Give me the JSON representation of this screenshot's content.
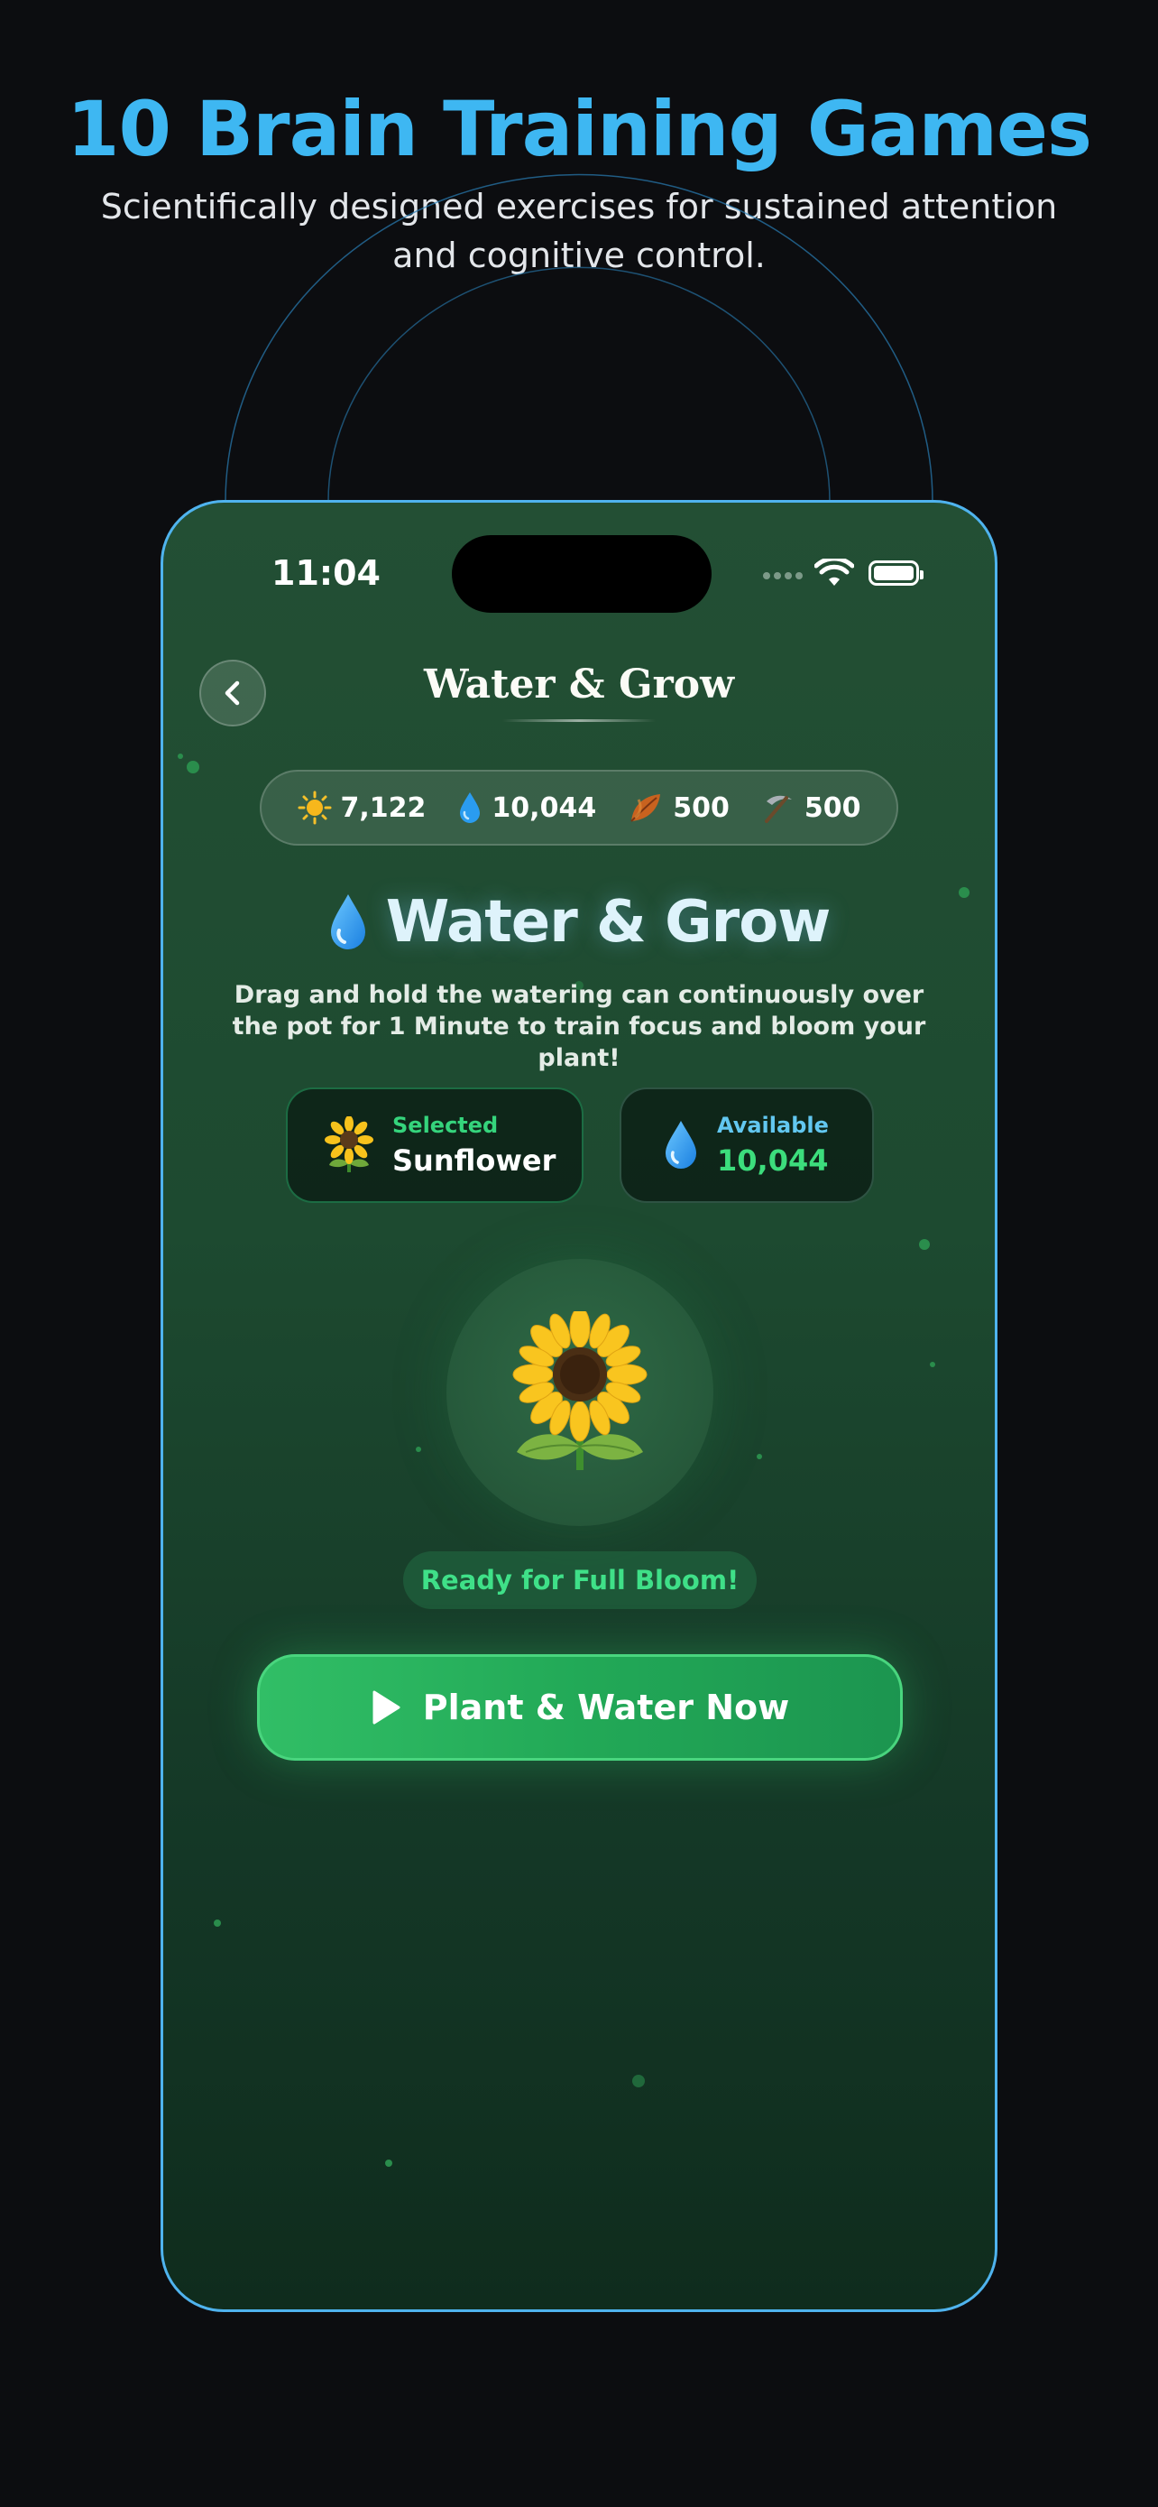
{
  "promo": {
    "title": "10 Brain Training Games",
    "subtitle": "Scientifically designed exercises for sustained attention and cognitive control.",
    "accent_color": "#3eb7f2"
  },
  "status_bar": {
    "time": "11:04",
    "icons": [
      "signal-icon",
      "wifi-icon",
      "battery-icon"
    ]
  },
  "nav": {
    "back_icon": "chevron-left-icon",
    "title": "Water & Grow"
  },
  "stats": [
    {
      "icon": "sun-icon",
      "value": "7,122"
    },
    {
      "icon": "water-drop-icon",
      "value": "10,044"
    },
    {
      "icon": "leaf-icon",
      "value": "500"
    },
    {
      "icon": "pickaxe-icon",
      "value": "500"
    }
  ],
  "game": {
    "icon": "water-drop-icon",
    "title": "Water & Grow",
    "description": "Drag and hold the watering can continuously over the pot for 1 Minute to train focus and bloom your plant!"
  },
  "selected_card": {
    "icon": "sunflower-icon",
    "label": "Selected",
    "value": "Sunflower"
  },
  "available_card": {
    "icon": "water-drop-icon",
    "label": "Available",
    "value": "10,044"
  },
  "plant": {
    "icon": "sunflower-icon"
  },
  "status": {
    "text": "Ready for Full Bloom!"
  },
  "cta": {
    "icon": "play-icon",
    "label": "Plant & Water Now",
    "color": "#2bb360"
  },
  "colors": {
    "background": "#0c0d10",
    "phone_border": "#4fb3ee",
    "screen_green": "#1d4a30",
    "success_green": "#3fe088"
  }
}
